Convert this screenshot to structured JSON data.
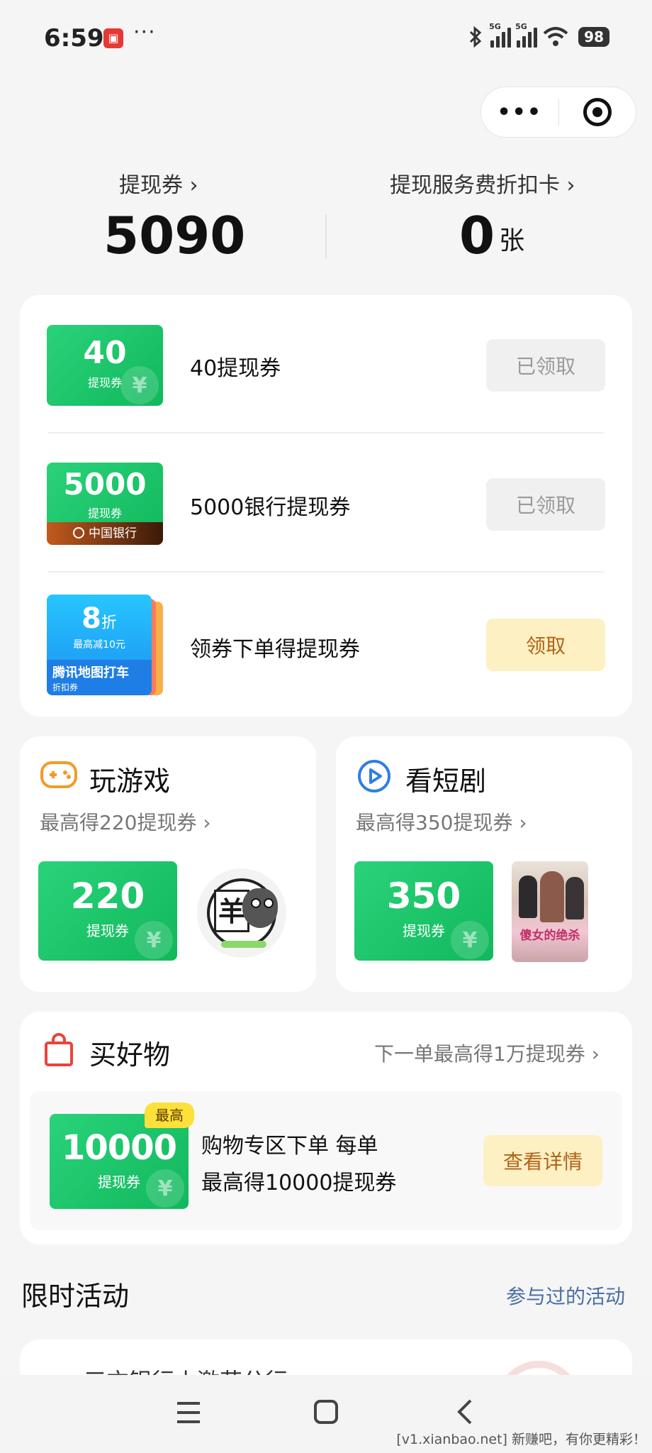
{
  "status_bar": {
    "time": "6:59",
    "app_badge": "▣",
    "more": "···",
    "net1": "5G",
    "net2": "5G",
    "battery": "98"
  },
  "capsule": {
    "more": "•••"
  },
  "header": {
    "left_label": "提现券 ›",
    "left_value": "5090",
    "right_label": "提现服务费折扣卡 ›",
    "right_value": "0",
    "right_unit": "张"
  },
  "coupons": [
    {
      "badge_num": "40",
      "badge_sub": "提现券",
      "title": "40提现券",
      "button": "已领取",
      "state": "claimed"
    },
    {
      "badge_num": "5000",
      "badge_sub": "提现券",
      "badge_bank": "中国银行",
      "title": "5000银行提现券",
      "button": "已领取",
      "state": "claimed"
    },
    {
      "badge_num": "8",
      "badge_unit": "折",
      "badge_sub": "最高减10元",
      "badge_brand": "腾讯地图打车",
      "badge_tag": "折扣券",
      "title": "领券下单得提现券",
      "button": "领取",
      "state": "available"
    }
  ],
  "game": {
    "title": "玩游戏",
    "subtitle": "最高得220提现券 ›",
    "coupon_num": "220",
    "coupon_sub": "提现券",
    "thumb_char": "羊"
  },
  "drama": {
    "title": "看短剧",
    "subtitle": "最高得350提现券 ›",
    "coupon_num": "350",
    "coupon_sub": "提现券",
    "poster_text": "傻女的绝杀"
  },
  "shop": {
    "title": "买好物",
    "link": "下一单最高得1万提现券 ›",
    "tag": "最高",
    "coupon_num": "10000",
    "coupon_sub": "提现券",
    "line1": "购物专区下单 每单",
    "line2": "最高得10000提现券",
    "button": "查看详情"
  },
  "activities": {
    "title": "限时活动",
    "link": "参与过的活动",
    "partial_item": "三方银行小激花分行"
  },
  "watermark": "[v1.xianbao.net] 新赚吧，有你更精彩！",
  "colors": {
    "green": "#19c565",
    "yellow_btn": "#fdf0c2",
    "link_blue": "#4a6fa5"
  }
}
